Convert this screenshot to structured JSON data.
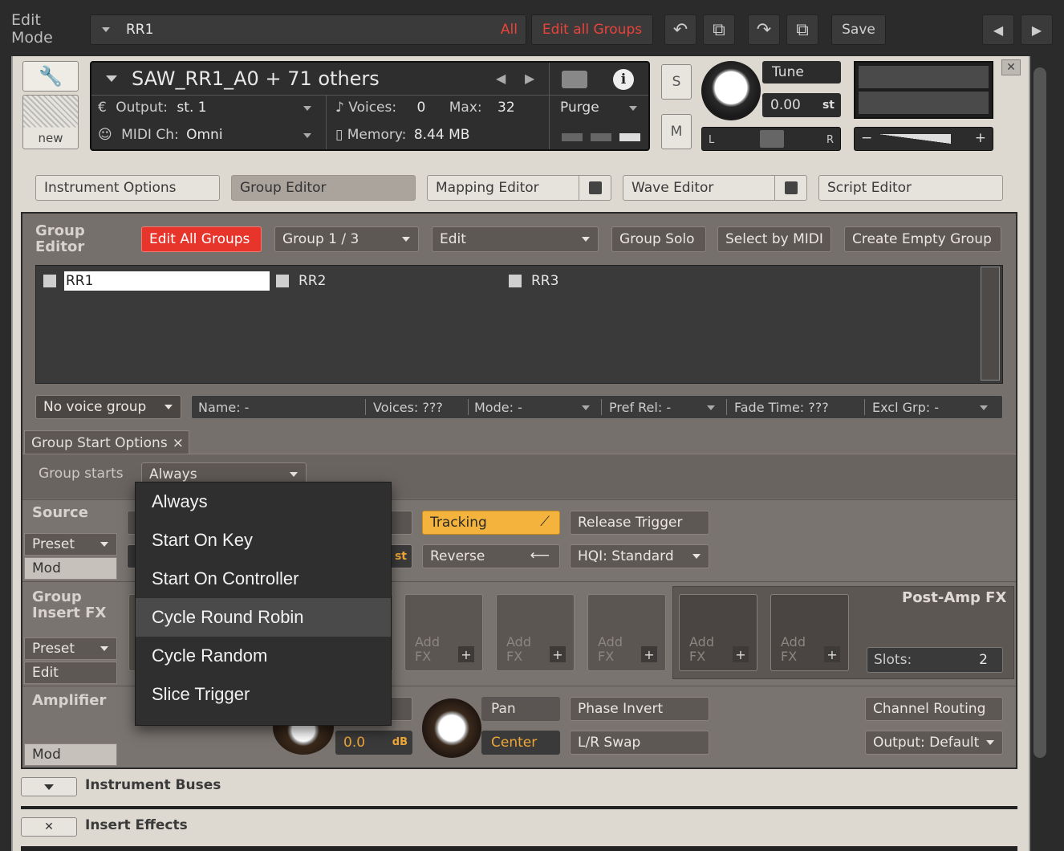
{
  "app": {
    "mode_label_1": "Edit",
    "mode_label_2": "Mode",
    "preset_name": "RR1",
    "filter_all": "All",
    "edit_all_groups": "Edit all Groups",
    "save": "Save"
  },
  "instrument": {
    "name": "SAW_RR1_A0 + 71 others",
    "output_label": "Output:",
    "output_value": "st. 1",
    "voices_label": "Voices:",
    "voices_value": "0",
    "max_label": "Max:",
    "max_value": "32",
    "midi_label": "MIDI Ch:",
    "midi_value": "Omni",
    "memory_label": "Memory:",
    "memory_value": "8.44 MB",
    "purge": "Purge",
    "solo": "S",
    "mute": "M",
    "tune_label": "Tune",
    "tune_value": "0.00",
    "tune_unit": "st",
    "pan_l": "L",
    "pan_r": "R",
    "new_label": "new"
  },
  "tabs": {
    "instrument_options": "Instrument Options",
    "group_editor": "Group Editor",
    "mapping_editor": "Mapping Editor",
    "wave_editor": "Wave Editor",
    "script_editor": "Script Editor"
  },
  "group_editor": {
    "title_1": "Group",
    "title_2": "Editor",
    "edit_all_groups": "Edit All Groups",
    "group_select": "Group 1 / 3",
    "edit": "Edit",
    "group_solo": "Group Solo",
    "select_by_midi": "Select by MIDI",
    "create_empty_group": "Create Empty Group",
    "groups": [
      "RR1",
      "RR2",
      "RR3"
    ]
  },
  "voice_bar": {
    "voice_group": "No voice group",
    "name": "Name: -",
    "voices": "Voices: ???",
    "mode": "Mode: -",
    "pref_rel": "Pref Rel: -",
    "fade_time": "Fade Time:  ???",
    "excl_grp": "Excl Grp:  -"
  },
  "start_options": {
    "tab_label": "Group Start Options",
    "close": "×",
    "group_starts_label": "Group starts",
    "group_starts_value": "Always"
  },
  "menu": {
    "items": [
      "Always",
      "Start On Key",
      "Start On Controller",
      "Cycle Round Robin",
      "Cycle Random",
      "Slice Trigger"
    ],
    "highlighted": "Cycle Round Robin"
  },
  "source": {
    "title": "Source",
    "preset": "Preset",
    "mod": "Mod",
    "tracking": "Tracking",
    "release_trigger": "Release Trigger",
    "reverse": "Reverse",
    "hqi": "HQI: Standard",
    "tune_unit": "st"
  },
  "insert_fx": {
    "title_1": "Group",
    "title_2": "Insert FX",
    "preset": "Preset",
    "edit": "Edit",
    "slot_label_1": "Add",
    "slot_label_2": "FX",
    "plus": "+",
    "post_amp_title": "Post-Amp FX",
    "slots_label": "Slots:",
    "slots_value": "2"
  },
  "amplifier": {
    "title": "Amplifier",
    "mod": "Mod",
    "volume_value": "0.0",
    "volume_unit": "dB",
    "pan_label": "Pan",
    "pan_value": "Center",
    "phase_invert": "Phase Invert",
    "lr_swap": "L/R Swap",
    "channel_routing": "Channel Routing",
    "output": "Output: Default"
  },
  "bottom": {
    "instrument_buses": "Instrument Buses",
    "insert_effects": "Insert Effects"
  }
}
